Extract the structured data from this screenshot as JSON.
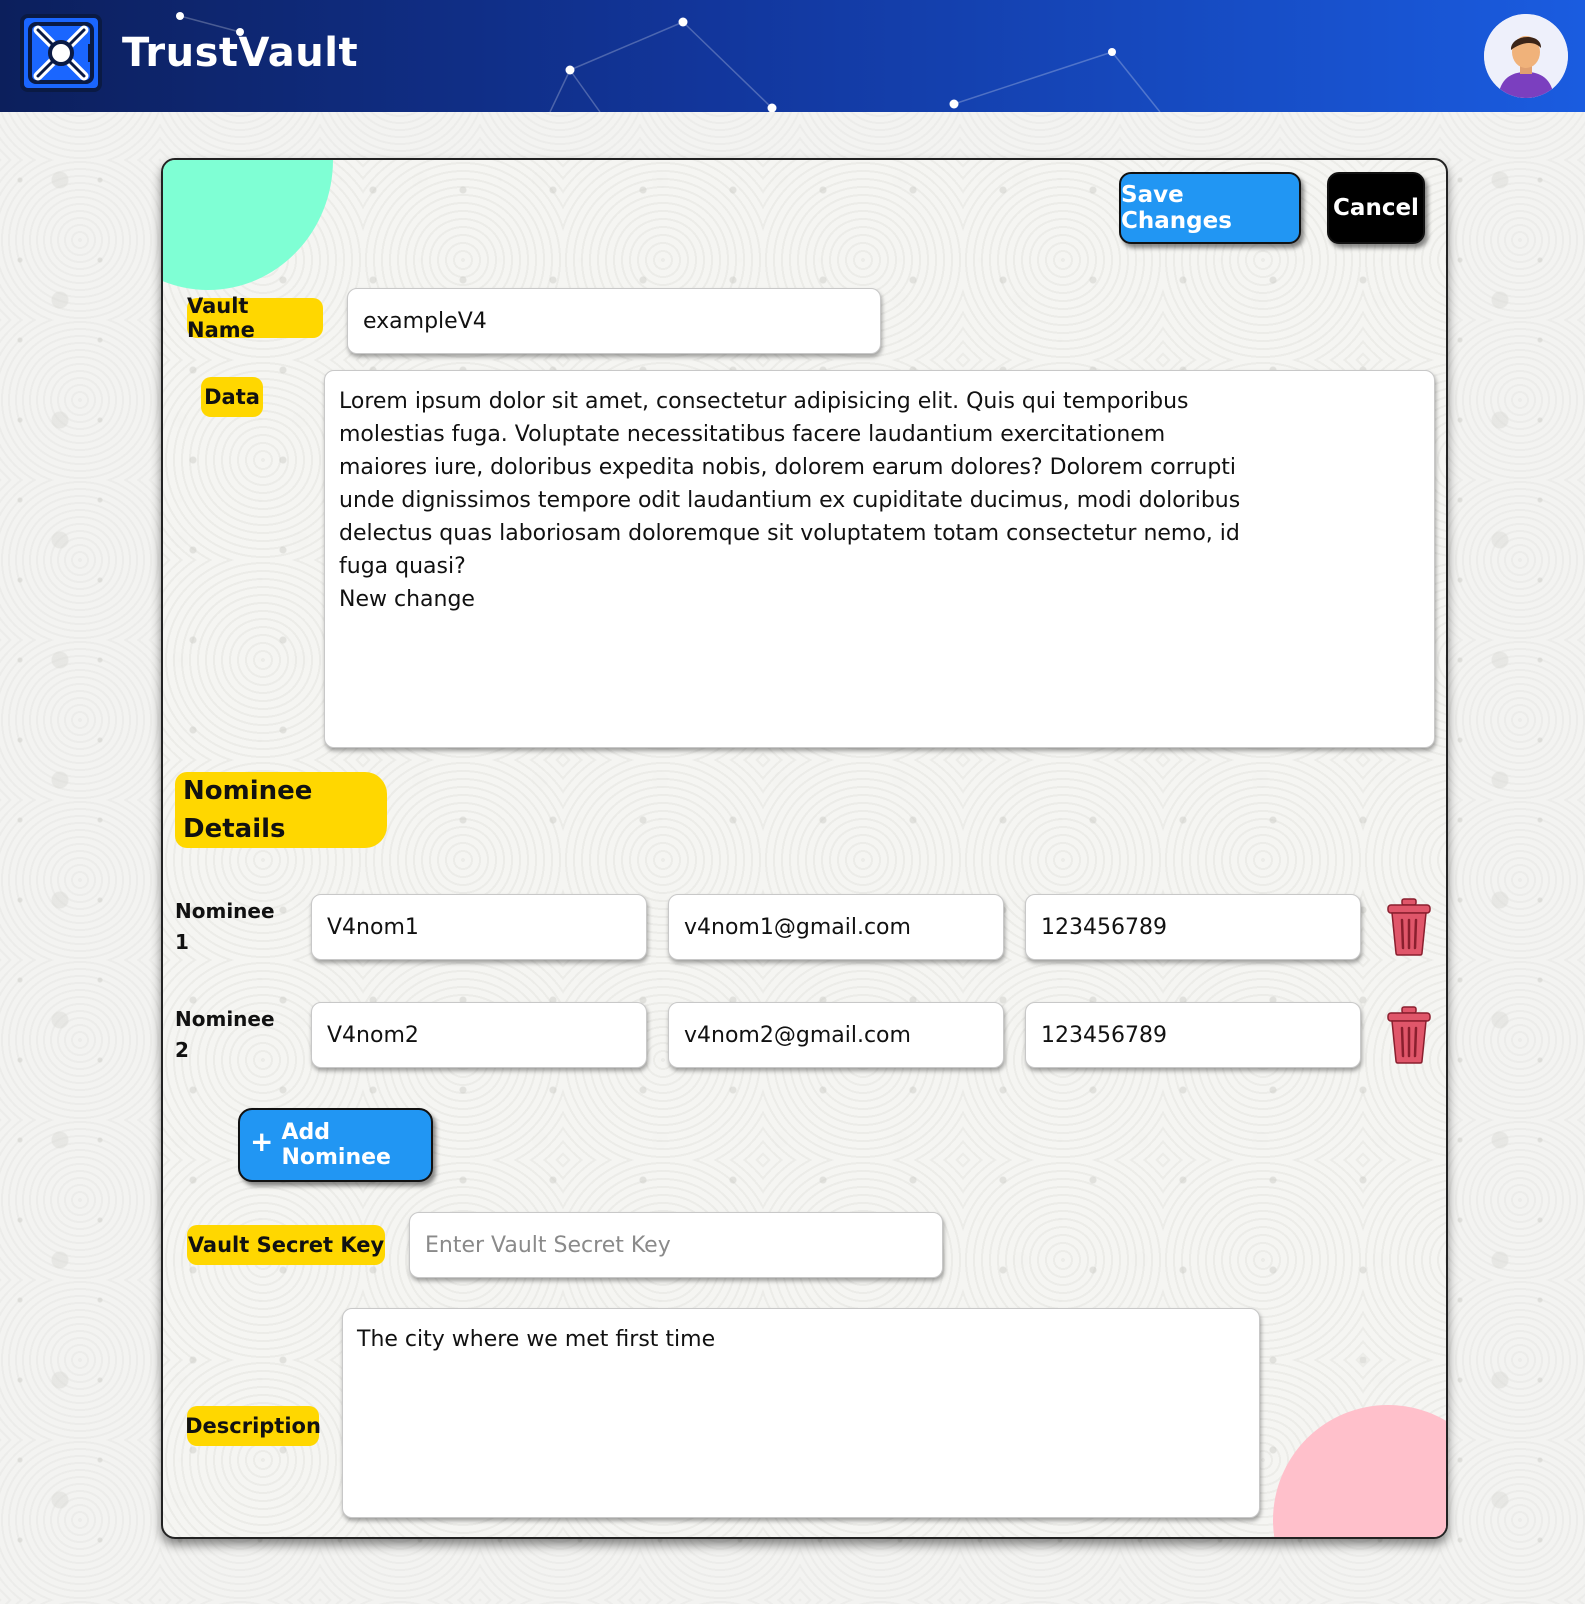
{
  "header": {
    "brand": "TrustVault",
    "logo_icon": "vault-x-logo-icon",
    "avatar_icon": "user-avatar-icon",
    "colors": {
      "gradient_start": "#0c1f5c",
      "gradient_end": "#1a5ce0"
    }
  },
  "actions": {
    "save_label": "Save Changes",
    "cancel_label": "Cancel",
    "save_color": "#2196f3",
    "cancel_color": "#000000"
  },
  "vault": {
    "name_label": "Vault Name",
    "name_value": "exampleV4",
    "data_label": "Data",
    "data_value": "Lorem ipsum dolor sit amet, consectetur adipisicing elit. Quis qui temporibus\nmolestias fuga. Voluptate necessitatibus facere laudantium exercitationem\nmaiores iure, doloribus expedita nobis, dolorem earum dolores? Dolorem corrupti\nunde dignissimos tempore odit laudantium ex cupiditate ducimus, modi doloribus\ndelectus quas laboriosam doloremque sit voluptatem totam consectetur nemo, id\nfuga quasi?\nNew change"
  },
  "nominees": {
    "section_label": "Nominee Details",
    "items": [
      {
        "label": "Nominee 1",
        "name": "V4nom1",
        "email": "v4nom1@gmail.com",
        "phone": "123456789",
        "delete_icon": "trash-icon"
      },
      {
        "label": "Nominee 2",
        "name": "V4nom2",
        "email": "v4nom2@gmail.com",
        "phone": "123456789",
        "delete_icon": "trash-icon"
      }
    ],
    "add_label": "Add Nominee",
    "add_icon": "plus-icon"
  },
  "secret": {
    "key_label": "Vault Secret Key",
    "key_placeholder": "Enter Vault Secret Key",
    "key_value": "",
    "description_label": "Description",
    "description_value": "The city where we met first time"
  },
  "theme": {
    "tag_color": "#ffd700",
    "accent_green": "#7fffd4",
    "accent_pink": "#ffc0cb",
    "trash_color": "#e0566a"
  }
}
